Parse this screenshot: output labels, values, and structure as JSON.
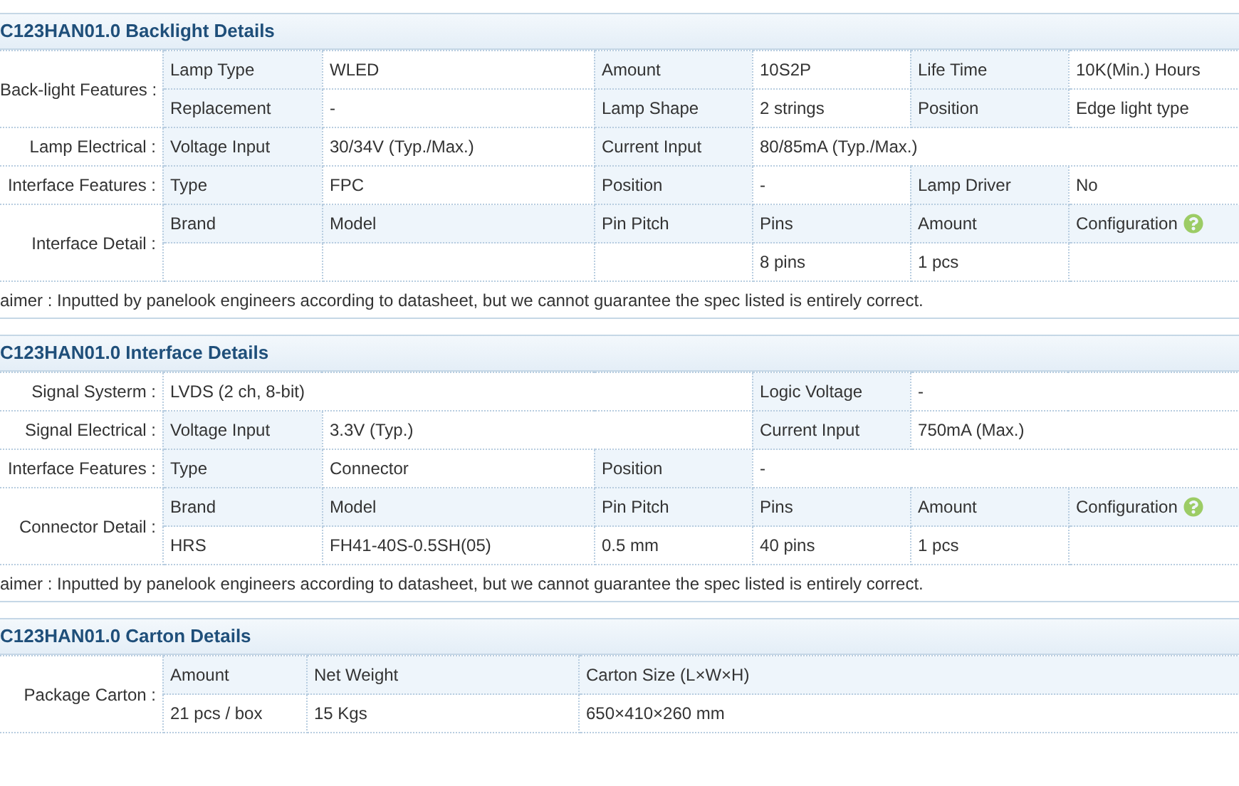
{
  "sections": [
    {
      "title": "C123HAN01.0 Backlight Details",
      "groups": [
        {
          "label": "Back-light Features :",
          "rows": [
            [
              {
                "kind": "head",
                "text": "Lamp Type"
              },
              {
                "kind": "value",
                "text": "WLED"
              },
              {
                "kind": "head",
                "text": "Amount"
              },
              {
                "kind": "value",
                "text": "10S2P"
              },
              {
                "kind": "head",
                "text": "Life Time"
              },
              {
                "kind": "value",
                "text": "10K(Min.) Hours"
              }
            ],
            [
              {
                "kind": "head",
                "text": "Replacement"
              },
              {
                "kind": "value",
                "text": "-"
              },
              {
                "kind": "head",
                "text": "Lamp Shape"
              },
              {
                "kind": "value",
                "text": "2 strings"
              },
              {
                "kind": "head",
                "text": "Position"
              },
              {
                "kind": "value",
                "text": "Edge light type"
              }
            ]
          ]
        },
        {
          "label": "Lamp Electrical :",
          "rows": [
            [
              {
                "kind": "head",
                "text": "Voltage Input"
              },
              {
                "kind": "value",
                "text": "30/34V (Typ./Max.)"
              },
              {
                "kind": "head",
                "text": "Current Input"
              },
              {
                "kind": "value",
                "text": "80/85mA (Typ./Max.)"
              }
            ]
          ]
        },
        {
          "label": "Interface Features :",
          "rows": [
            [
              {
                "kind": "head",
                "text": "Type"
              },
              {
                "kind": "value",
                "text": "FPC"
              },
              {
                "kind": "head",
                "text": "Position"
              },
              {
                "kind": "value",
                "text": "-"
              },
              {
                "kind": "head",
                "text": "Lamp Driver"
              },
              {
                "kind": "value",
                "text": "No"
              }
            ]
          ]
        },
        {
          "label": "Interface Detail :",
          "rows": [
            [
              {
                "kind": "head",
                "text": "Brand"
              },
              {
                "kind": "head",
                "text": "Model"
              },
              {
                "kind": "head",
                "text": "Pin Pitch"
              },
              {
                "kind": "head",
                "text": "Pins"
              },
              {
                "kind": "head",
                "text": "Amount"
              },
              {
                "kind": "head",
                "text": "Configuration",
                "help": true
              }
            ],
            [
              {
                "kind": "value"
              },
              {
                "kind": "value"
              },
              {
                "kind": "value"
              },
              {
                "kind": "value",
                "text": "8 pins"
              },
              {
                "kind": "value",
                "text": "1 pcs"
              },
              {
                "kind": "value"
              }
            ]
          ]
        }
      ],
      "disclaimer": "aimer : Inputted by panelook engineers according to datasheet, but we cannot guarantee the spec listed is entirely correct."
    },
    {
      "title": "C123HAN01.0 Interface Details",
      "groups": [
        {
          "label": "Signal Systerm :",
          "rows": [
            [
              {
                "kind": "value",
                "text": "LVDS (2 ch, 8-bit)"
              },
              {
                "kind": "head",
                "text": "Logic Voltage"
              },
              {
                "kind": "value",
                "text": "-"
              }
            ]
          ]
        },
        {
          "label": "Signal Electrical :",
          "rows": [
            [
              {
                "kind": "head",
                "text": "Voltage Input"
              },
              {
                "kind": "value",
                "text": "3.3V (Typ.)"
              },
              {
                "kind": "head",
                "text": "Current Input"
              },
              {
                "kind": "value",
                "text": "750mA (Max.)"
              }
            ]
          ]
        },
        {
          "label": "Interface Features :",
          "rows": [
            [
              {
                "kind": "head",
                "text": "Type"
              },
              {
                "kind": "value",
                "text": "Connector"
              },
              {
                "kind": "head",
                "text": "Position"
              },
              {
                "kind": "value",
                "text": "-"
              }
            ]
          ]
        },
        {
          "label": "Connector Detail :",
          "rows": [
            [
              {
                "kind": "head",
                "text": "Brand"
              },
              {
                "kind": "head",
                "text": "Model"
              },
              {
                "kind": "head",
                "text": "Pin Pitch"
              },
              {
                "kind": "head",
                "text": "Pins"
              },
              {
                "kind": "head",
                "text": "Amount"
              },
              {
                "kind": "head",
                "text": "Configuration",
                "help": true
              }
            ],
            [
              {
                "kind": "value",
                "text": "HRS"
              },
              {
                "kind": "value",
                "text": "FH41-40S-0.5SH(05)"
              },
              {
                "kind": "value",
                "text": "0.5 mm"
              },
              {
                "kind": "value",
                "text": "40 pins"
              },
              {
                "kind": "value",
                "text": "1 pcs"
              },
              {
                "kind": "value"
              }
            ]
          ]
        }
      ],
      "disclaimer": "aimer : Inputted by panelook engineers according to datasheet, but we cannot guarantee the spec listed is entirely correct."
    },
    {
      "title": "C123HAN01.0 Carton Details",
      "groups": [
        {
          "label": "Package Carton :",
          "rows": [
            [
              {
                "kind": "head",
                "text": "Amount"
              },
              {
                "kind": "head",
                "text": "Net Weight"
              },
              {
                "kind": "head",
                "text": "Carton Size (L×W×H)"
              }
            ],
            [
              {
                "kind": "value",
                "text": "21 pcs / box"
              },
              {
                "kind": "value",
                "text": "15 Kgs"
              },
              {
                "kind": "value",
                "text": "650×410×260 mm"
              }
            ]
          ]
        }
      ]
    }
  ]
}
